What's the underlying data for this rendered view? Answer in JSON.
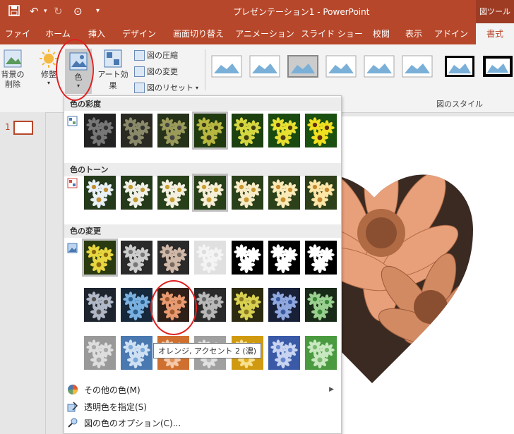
{
  "window": {
    "title": "プレゼンテーション1 - PowerPoint",
    "picture_tools_label": "図ツール"
  },
  "tabs": [
    {
      "label": "ファイル"
    },
    {
      "label": "ホーム"
    },
    {
      "label": "挿入"
    },
    {
      "label": "デザイン"
    },
    {
      "label": "画面切り替え"
    },
    {
      "label": "アニメーション"
    },
    {
      "label": "スライド ショー"
    },
    {
      "label": "校閲"
    },
    {
      "label": "表示"
    },
    {
      "label": "アドイン"
    },
    {
      "label": "書式"
    }
  ],
  "ribbon": {
    "remove_background": "背景の\n削除",
    "corrections": "修整",
    "color": "色",
    "artistic_effects": "アート効果",
    "compress": "図の圧縮",
    "change_picture": "図の変更",
    "reset_picture": "図のリセット",
    "picture_styles_label": "図のスタイル"
  },
  "slide_panel": {
    "slide_number": "1"
  },
  "dropdown": {
    "saturation_header": "色の彩度",
    "tone_header": "色のトーン",
    "recolor_header": "色の変更",
    "more_colors": "その他の色(M)",
    "set_transparent": "透明色を指定(S)",
    "color_options": "図の色のオプション(C)..."
  },
  "tooltip": "オレンジ, アクセント 2 (濃)",
  "colors": {
    "accent": "#b7472a",
    "highlight_ring": "#e02020"
  }
}
